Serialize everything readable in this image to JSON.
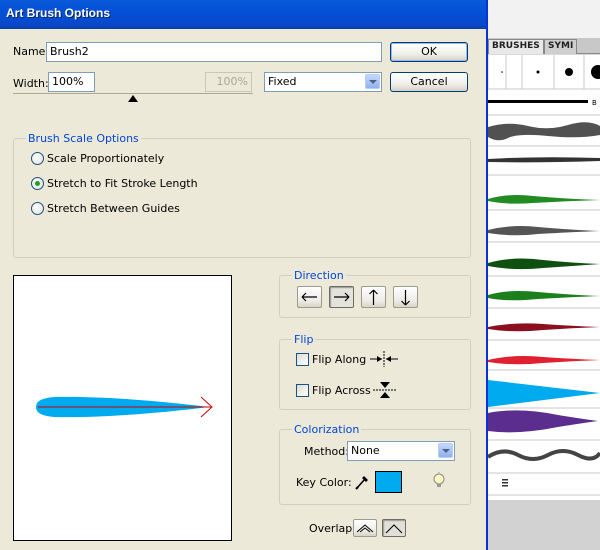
{
  "dialog": {
    "title": "Art Brush Options",
    "name_label": "Name:",
    "name_value": "Brush2",
    "width_label": "Width:",
    "width_value": "100%",
    "width_secondary_value": "100%",
    "width_mode_selected": "Fixed",
    "width_slider_position": 0.5,
    "ok_label": "OK",
    "cancel_label": "Cancel"
  },
  "brush_scale": {
    "legend": "Brush Scale Options",
    "options": [
      {
        "label": "Scale Proportionately",
        "checked": false
      },
      {
        "label": "Stretch to Fit Stroke Length",
        "checked": true
      },
      {
        "label": "Stretch Between Guides",
        "checked": false
      }
    ]
  },
  "direction": {
    "legend": "Direction",
    "buttons": [
      {
        "icon": "arrow-left-icon",
        "glyph": "⟵",
        "pressed": false
      },
      {
        "icon": "arrow-right-icon",
        "glyph": "⟶",
        "pressed": true
      },
      {
        "icon": "arrow-up-icon",
        "glyph": "↑",
        "pressed": false
      },
      {
        "icon": "arrow-down-icon",
        "glyph": "↓",
        "pressed": false
      }
    ]
  },
  "flip": {
    "legend": "Flip",
    "along_label": "Flip Along",
    "across_label": "Flip Across",
    "along_checked": false,
    "across_checked": false
  },
  "colorization": {
    "legend": "Colorization",
    "method_label": "Method:",
    "method_selected": "None",
    "key_color_label": "Key Color:",
    "key_color": "#00aaee"
  },
  "overlap": {
    "label": "Overlap:"
  },
  "preview": {
    "brush_color": "#00aaee",
    "arrow_color": "#cc0000"
  },
  "brushes_panel": {
    "tabs": [
      "BRUSHES",
      "SYMI"
    ],
    "brush_colors": [
      "#333333",
      "#333333",
      "#228b22",
      "#555555",
      "#0f4f0f",
      "#1b7f1b",
      "#8b0f1f",
      "#e02030",
      "#00aaee",
      "#5b2d8e",
      "#444444"
    ]
  }
}
